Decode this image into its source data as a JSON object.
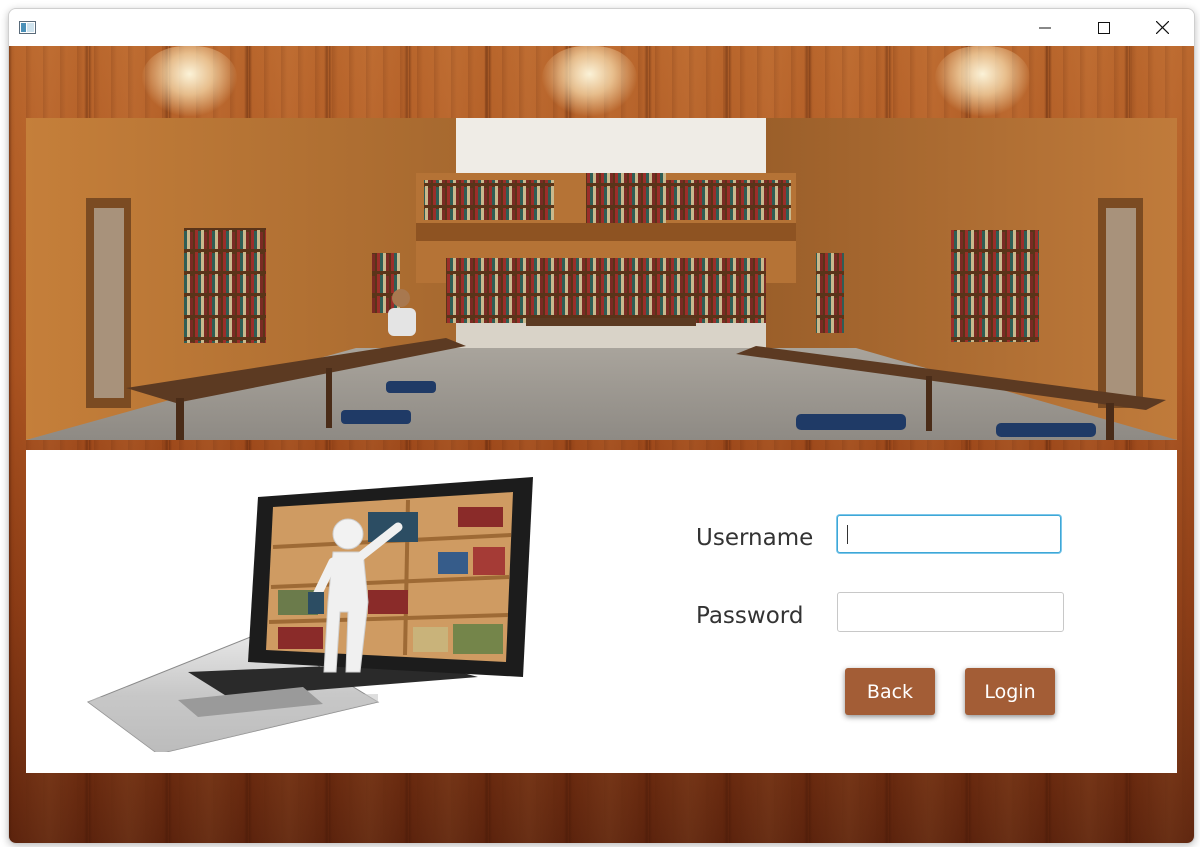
{
  "window": {
    "title": "",
    "controls": {
      "minimize_icon": "minimize-icon",
      "maximize_icon": "maximize-icon",
      "close_icon": "close-icon"
    }
  },
  "banner": {
    "image": "library-reading-room-photo"
  },
  "illustration": {
    "image": "laptop-bookshelf-illustration"
  },
  "login": {
    "username_label": "Username",
    "username_value": "",
    "password_label": "Password",
    "password_value": "",
    "back_label": "Back",
    "login_label": "Login"
  },
  "colors": {
    "button_bg": "#a35d36",
    "focus_border": "#3ea7d6",
    "wood": "#a9521f"
  }
}
